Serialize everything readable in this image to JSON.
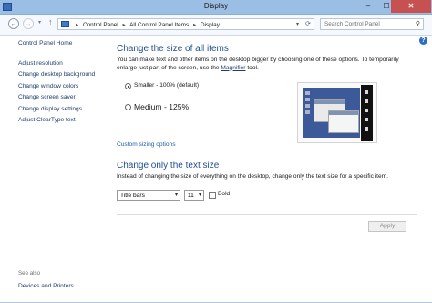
{
  "window": {
    "title": "Display",
    "min_label": "–",
    "max_label": "☐",
    "close_label": "✕"
  },
  "nav": {
    "back_icon": "←",
    "forward_icon": "→",
    "recent_icon": "▾",
    "up_icon": "↑",
    "breadcrumbs": [
      "Control Panel",
      "All Control Panel Items",
      "Display"
    ],
    "separator": "▸",
    "refresh_icon": "⟳",
    "dropdown_icon": "▾",
    "search_placeholder": "Search Control Panel",
    "search_icon": "⚲"
  },
  "sidebar": {
    "home": "Control Panel Home",
    "items": [
      "Adjust resolution",
      "Change desktop background",
      "Change window colors",
      "Change screen saver",
      "Change display settings",
      "Adjust ClearType text"
    ],
    "see_also_label": "See also",
    "see_also_items": [
      "Devices and Printers"
    ]
  },
  "main": {
    "help_icon": "?",
    "size_heading": "Change the size of all items",
    "size_desc_pre": "You can make text and other items on the desktop bigger by choosing one of these options. To temporarily enlarge just part of the screen, use the ",
    "size_desc_link": "Magnifier",
    "size_desc_post": " tool.",
    "options": [
      {
        "label": "Smaller - 100% (default)",
        "checked": true
      },
      {
        "label": "Medium - 125%",
        "checked": false
      }
    ],
    "custom_link": "Custom sizing options",
    "text_heading": "Change only the text size",
    "text_desc": "Instead of changing the size of everything on the desktop, change only the text size for a specific item.",
    "item_select": "Title bars",
    "size_select": "11",
    "bold_label": "Bold",
    "bold_checked": false,
    "apply_label": "Apply"
  },
  "colors": {
    "titlebar": "#9bbfe4",
    "link": "#1e3d6e",
    "heading": "#1f4e90",
    "close": "#c75050"
  }
}
